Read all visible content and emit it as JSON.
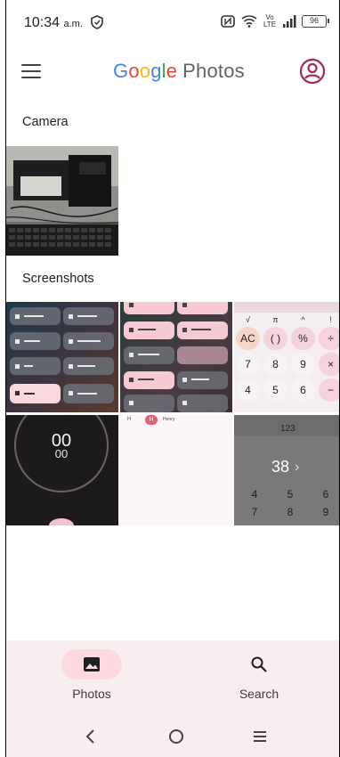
{
  "status_bar": {
    "time": "10:34",
    "time_suffix": "a.m.",
    "network": "Vo LTE",
    "battery": "96"
  },
  "app_bar": {
    "logo_google": [
      "G",
      "o",
      "o",
      "g",
      "l",
      "e"
    ],
    "logo_colors": [
      "#4285F4",
      "#EA4335",
      "#FBBC05",
      "#4285F4",
      "#34A853",
      "#EA4335"
    ],
    "logo_photos": "Photos"
  },
  "sections": {
    "camera": "Camera",
    "screenshots": "Screenshots"
  },
  "screenshots": {
    "calculator_keys": [
      "√",
      "π",
      "^",
      "!",
      "AC",
      "( )",
      "%",
      "÷",
      "7",
      "8",
      "9",
      "×",
      "4",
      "5",
      "6",
      "−"
    ],
    "timer": {
      "minutes": "00",
      "seconds": "00"
    },
    "calc_value": "38",
    "calc_top": "123",
    "calc_keys_small": [
      "4",
      "5",
      "6",
      "7",
      "8",
      "9"
    ],
    "notif_name": "Henry"
  },
  "bottom_nav": {
    "photos_label": "Photos",
    "search_label": "Search"
  },
  "colors": {
    "accent": "#a8294f",
    "nav_bg": "#f8eef0",
    "pill": "#fdd8e0"
  }
}
